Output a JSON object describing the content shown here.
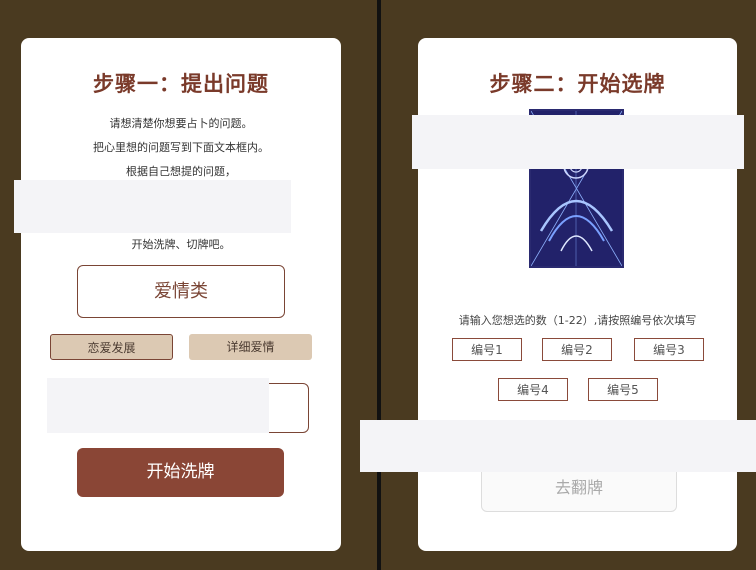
{
  "left": {
    "title": "步骤一：提出问题",
    "line1": "请想清楚你想要占卜的问题。",
    "line2": "把心里想的问题写到下面文本框内。",
    "line3": "根据自己想提的问题，",
    "line4": "开始洗牌、切牌吧。",
    "category": "爱情类",
    "tags": [
      "恋爱发展",
      "详细爱情"
    ],
    "start_button": "开始洗牌"
  },
  "right": {
    "title": "步骤二：开始选牌",
    "instruction": "请输入您想选的数（1-22）,请按照编号依次填写",
    "fields": [
      "编号1",
      "编号2",
      "编号3",
      "编号4",
      "编号5"
    ],
    "flip_button": "去翻牌"
  },
  "colors": {
    "background": "#4a3a20",
    "accent": "#7a3a2a",
    "primary_button": "#8a4636",
    "tag": "#dcc9b3"
  }
}
